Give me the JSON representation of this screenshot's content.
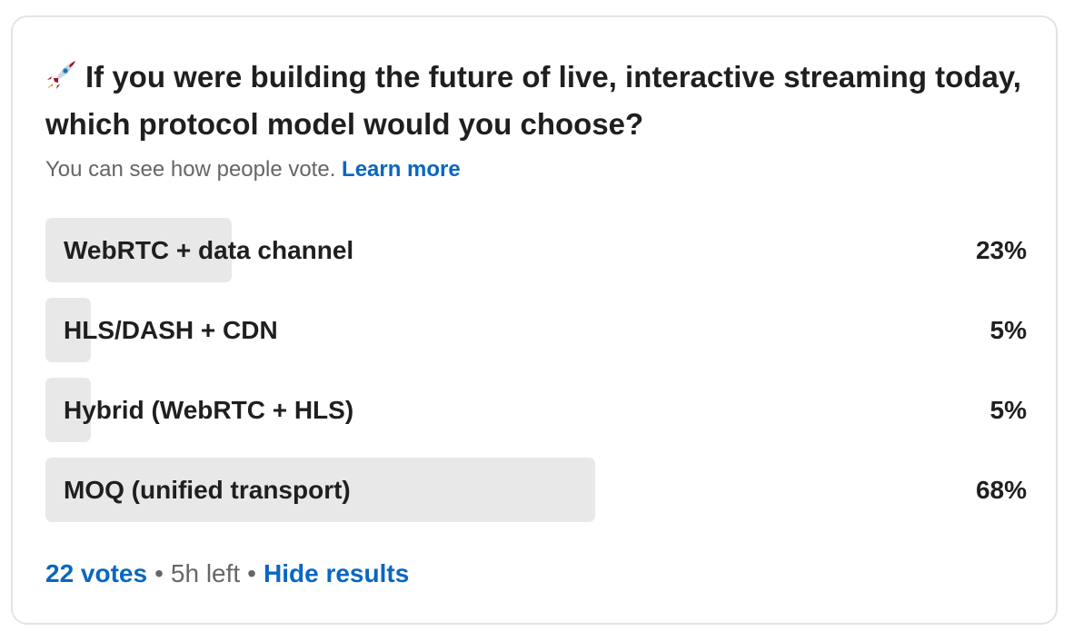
{
  "poll": {
    "question": "If you were building the future of live, interactive streaming today, which protocol model would you choose?",
    "visibility_note": "You can see how people vote.",
    "learn_more_label": "Learn more",
    "options": [
      {
        "label": "WebRTC + data channel",
        "percent_label": "23%",
        "percent": 23
      },
      {
        "label": "HLS/DASH + CDN",
        "percent_label": "5%",
        "percent": 5
      },
      {
        "label": "Hybrid (WebRTC + HLS)",
        "percent_label": "5%",
        "percent": 5
      },
      {
        "label": "MOQ (unified transport)",
        "percent_label": "68%",
        "percent": 68
      }
    ],
    "footer": {
      "votes_label": "22 votes",
      "time_left": "5h left",
      "hide_results_label": "Hide results",
      "separator": "•"
    }
  },
  "colors": {
    "link": "#0a66c2",
    "bar_fill": "#e8e8e8",
    "muted_text": "#666666"
  },
  "icons": {
    "question_icon": "rocket-icon"
  }
}
